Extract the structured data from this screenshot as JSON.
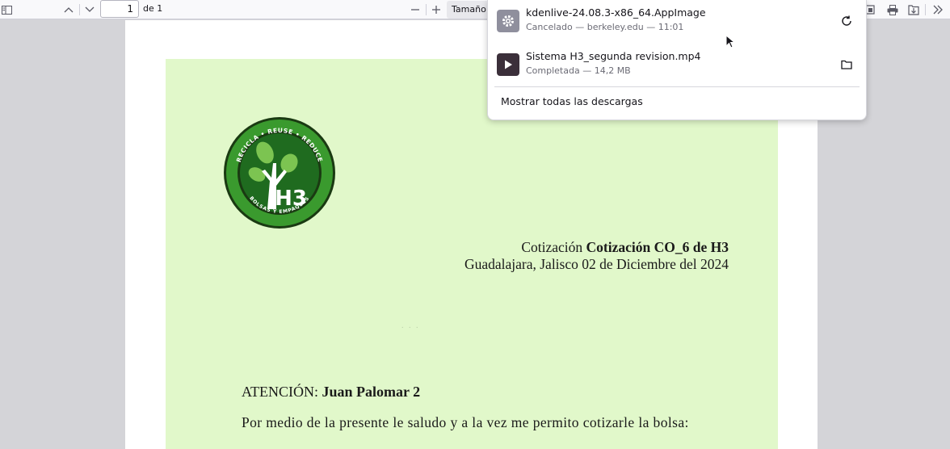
{
  "toolbar": {
    "page_number": "1",
    "page_of": "de 1",
    "zoom_label": "Tamaño a"
  },
  "document": {
    "cotizacion_prefix": "Cotización",
    "cotizacion_bold": "Cotización CO_6 de H3",
    "location_date": "Guadalajara, Jalisco 02 de Diciembre del 2024",
    "atencion_label": "ATENCIÓN:",
    "atencion_name": "Juan Palomar 2",
    "paragraph": "Por medio de la presente le saludo y a la vez me permito cotizarle la bolsa:",
    "logo": {
      "ring_text_top": "RECICLA • REUSE • REDUCE",
      "ring_text_bottom": "BOLSAS Y EMPAQUES",
      "center_text": "H3",
      "colors": {
        "ring": "#3a9a2e",
        "inner": "#1f6b1f",
        "leaf": "#7cc451"
      }
    }
  },
  "downloads": {
    "items": [
      {
        "name": "kdenlive-24.08.3-x86_64.AppImage",
        "status": "Cancelado — berkeley.edu — 11:01",
        "icon": "gear-icon",
        "action": "retry-icon"
      },
      {
        "name": "Sistema H3_segunda revision.mp4",
        "status": "Completada — 14,2 MB",
        "icon": "play-icon",
        "action": "folder-icon"
      }
    ],
    "show_all": "Mostrar todas las descargas"
  },
  "colors": {
    "letter_background": "#e1f8ca",
    "viewer_background": "#d4d4d8",
    "toolbar": "#f9f9fb"
  }
}
